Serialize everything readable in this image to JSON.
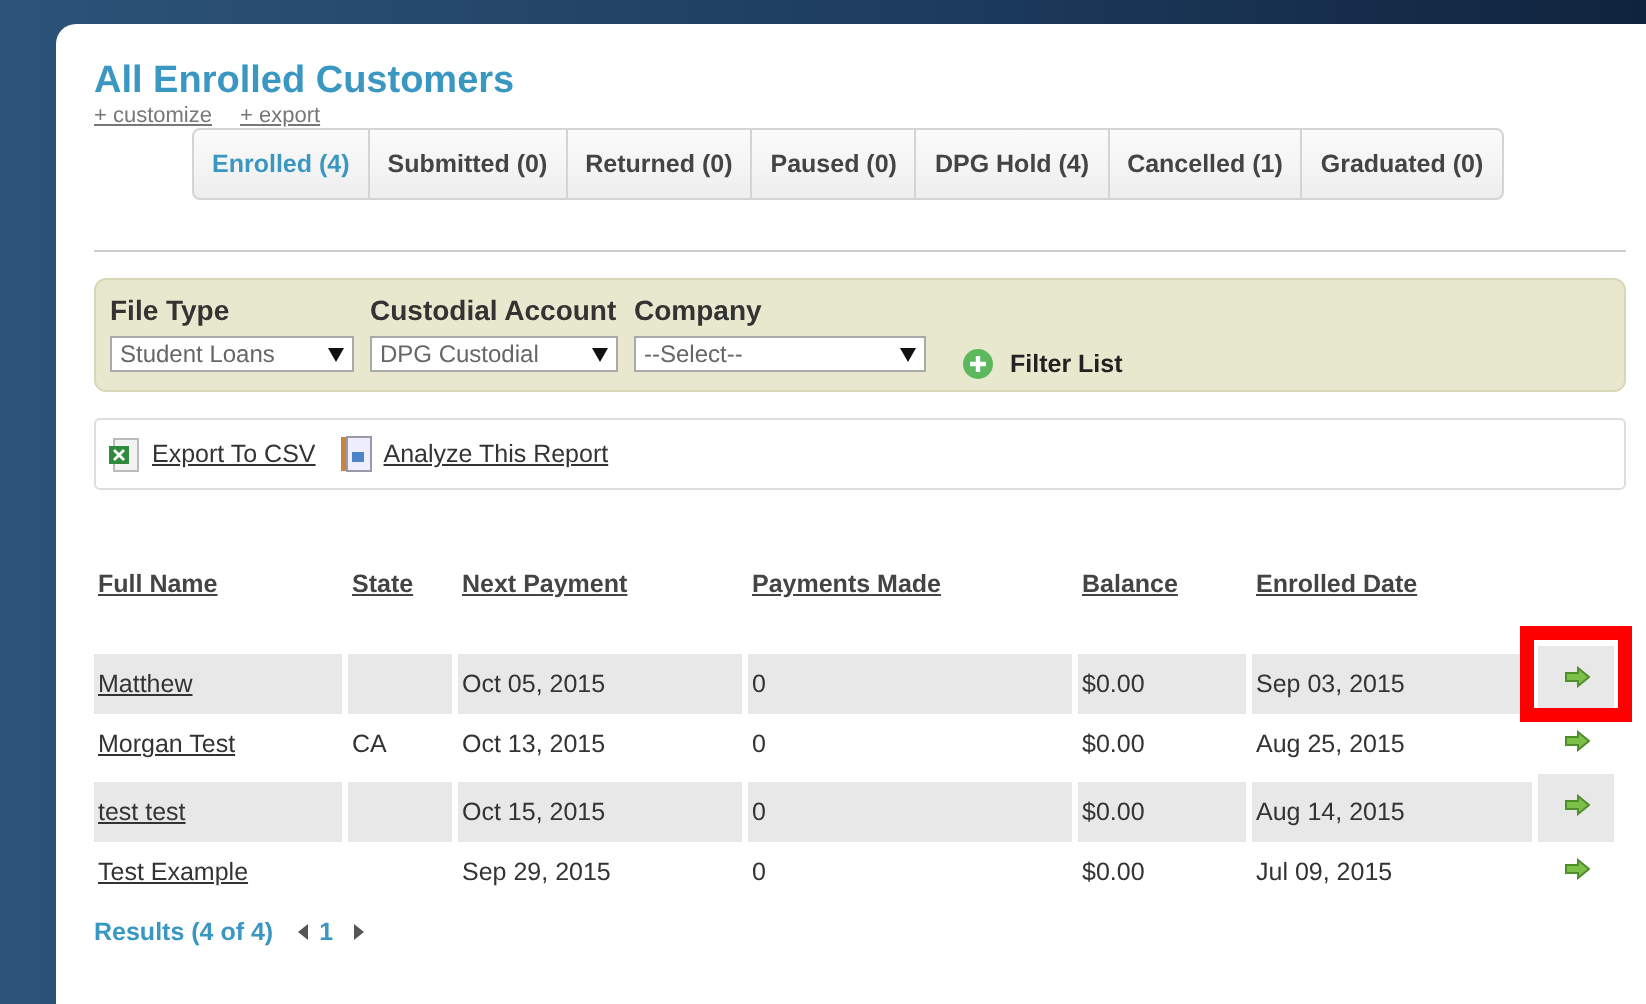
{
  "title": "All Enrolled Customers",
  "links": [
    "+ customize",
    "+ export"
  ],
  "tabs": [
    {
      "label": "Enrolled (4)",
      "selected": true
    },
    {
      "label": "Submitted (0)",
      "selected": false
    },
    {
      "label": "Returned (0)",
      "selected": false
    },
    {
      "label": "Paused (0)",
      "selected": false
    },
    {
      "label": "DPG Hold (4)",
      "selected": false
    },
    {
      "label": "Cancelled (1)",
      "selected": false
    },
    {
      "label": "Graduated (0)",
      "selected": false
    }
  ],
  "filters": [
    {
      "label": "File Type",
      "value": "Student Loans"
    },
    {
      "label": "Custodial Account",
      "value": "DPG Custodial"
    },
    {
      "label": "Company",
      "value": "--Select--"
    }
  ],
  "filter_button": "Filter List",
  "actions": [
    {
      "kind": "csv",
      "label": "Export To CSV"
    },
    {
      "kind": "report",
      "label": "Analyze This Report"
    }
  ],
  "table": {
    "columns": [
      "Full Name",
      "State",
      "Next Payment",
      "Payments Made",
      "Balance",
      "Enrolled Date"
    ],
    "rows": [
      {
        "cells": [
          "Matthew",
          "",
          "Oct 05, 2015",
          "0",
          "$0.00",
          "Sep 03, 2015"
        ],
        "highlighted": true
      },
      {
        "cells": [
          "Morgan Test",
          "CA",
          "Oct 13, 2015",
          "0",
          "$0.00",
          "Aug 25, 2015"
        ],
        "highlighted": false
      },
      {
        "cells": [
          "test test",
          "",
          "Oct 15, 2015",
          "0",
          "$0.00",
          "Aug 14, 2015"
        ],
        "highlighted": false
      },
      {
        "cells": [
          "Test Example",
          "",
          "Sep 29, 2015",
          "0",
          "$0.00",
          "Jul 09, 2015"
        ],
        "highlighted": false
      }
    ]
  },
  "pagination": {
    "results": "Results (4 of 4)",
    "page": "1"
  }
}
